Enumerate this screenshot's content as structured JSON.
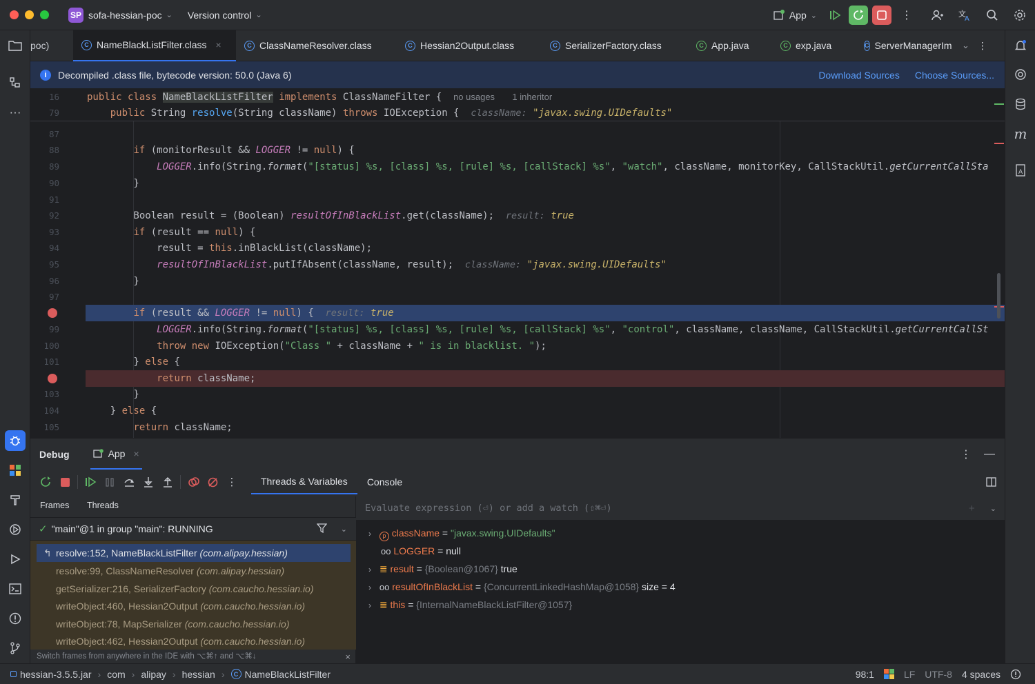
{
  "titlebar": {
    "project_badge": "SP",
    "project_name": "sofa-hessian-poc",
    "vcs_label": "Version control",
    "run_config": "App"
  },
  "tabs": [
    {
      "label": "poc)"
    },
    {
      "label": "NameBlackListFilter.class",
      "active": true
    },
    {
      "label": "ClassNameResolver.class"
    },
    {
      "label": "Hessian2Output.class"
    },
    {
      "label": "SerializerFactory.class"
    },
    {
      "label": "App.java"
    },
    {
      "label": "exp.java"
    },
    {
      "label": "ServerManagerIm"
    }
  ],
  "banner": {
    "text": "Decompiled .class file, bytecode version: 50.0 (Java 6)",
    "download_label": "Download Sources",
    "choose_label": "Choose Sources..."
  },
  "editor": {
    "sticky": [
      {
        "ln": "16",
        "usages": "no usages",
        "inheritors": "1 inheritor"
      },
      {
        "ln": "79",
        "hint_label": "className:",
        "hint_value": "\"javax.swing.UIDefaults\""
      }
    ],
    "line_numbers": [
      "87",
      "88",
      "89",
      "90",
      "91",
      "92",
      "93",
      "94",
      "95",
      "96",
      "97",
      "",
      "99",
      "100",
      "101",
      "",
      "103",
      "104",
      "105"
    ],
    "hints": {
      "result_label": "result:",
      "result_value": "true",
      "classname_label": "className:",
      "classname_value": "\"javax.swing.UIDefaults\""
    }
  },
  "debug": {
    "title": "Debug",
    "session_tab": "App",
    "tab_threads_vars": "Threads & Variables",
    "tab_console": "Console",
    "subtab_frames": "Frames",
    "subtab_threads": "Threads",
    "thread_status": "\"main\"@1 in group \"main\": RUNNING",
    "frames": [
      {
        "method": "resolve:152, NameBlackListFilter",
        "pkg": "(com.alipay.hessian)"
      },
      {
        "method": "resolve:99, ClassNameResolver",
        "pkg": "(com.alipay.hessian)"
      },
      {
        "method": "getSerializer:216, SerializerFactory",
        "pkg": "(com.caucho.hessian.io)"
      },
      {
        "method": "writeObject:460, Hessian2Output",
        "pkg": "(com.caucho.hessian.io)"
      },
      {
        "method": "writeObject:78, MapSerializer",
        "pkg": "(com.caucho.hessian.io)"
      },
      {
        "method": "writeObject:462, Hessian2Output",
        "pkg": "(com.caucho.hessian.io)"
      }
    ],
    "frames_hint": "Switch frames from anywhere in the IDE with ⌥⌘↑ and ⌥⌘↓",
    "eval_placeholder": "Evaluate expression (⏎) or add a watch (⇧⌘⏎)",
    "variables": [
      {
        "name": "className",
        "eq": " = ",
        "value": "\"javax.swing.UIDefaults\"",
        "extra": ""
      },
      {
        "name": "LOGGER",
        "eq": " = ",
        "value": "null",
        "extra": ""
      },
      {
        "name": "result",
        "eq": " = ",
        "value": "{Boolean@1067}",
        "extra": "true"
      },
      {
        "name": "resultOfInBlackList",
        "eq": " = ",
        "value": "{ConcurrentLinkedHashMap@1058}",
        "extra": "size = 4"
      },
      {
        "name": "this",
        "eq": " = ",
        "value": "{InternalNameBlackListFilter@1057}",
        "extra": ""
      }
    ]
  },
  "statusbar": {
    "crumbs": [
      "hessian-3.5.5.jar",
      "com",
      "alipay",
      "hessian",
      "NameBlackListFilter"
    ],
    "position": "98:1",
    "line_sep": "LF",
    "encoding": "UTF-8",
    "indent": "4 spaces"
  },
  "colors": {
    "accent": "#3574f0",
    "breakpoint": "#db5c5c",
    "execution_line": "#2e436e",
    "breakpoint_line": "#4a2b2e"
  }
}
